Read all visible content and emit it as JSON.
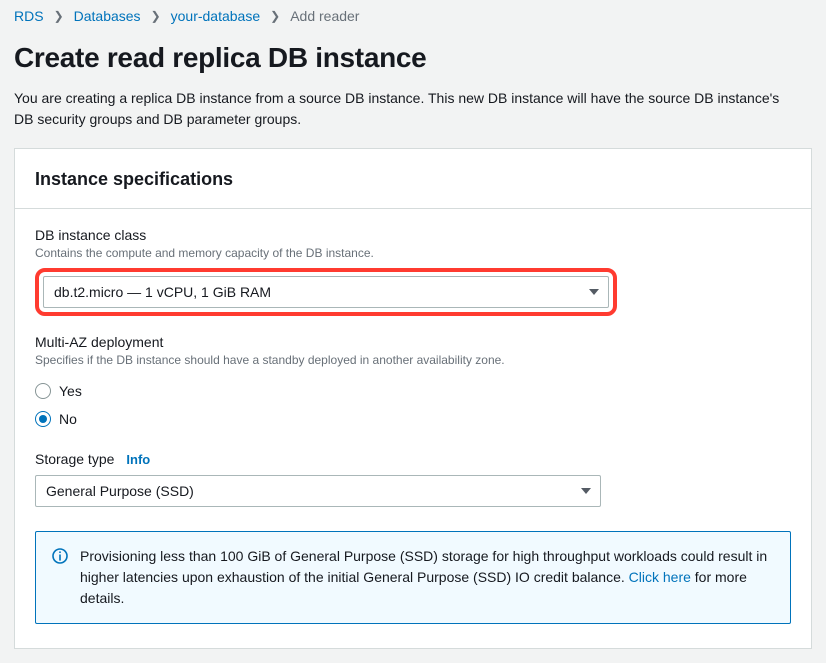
{
  "breadcrumb": {
    "items": [
      {
        "label": "RDS"
      },
      {
        "label": "Databases"
      },
      {
        "label": "your-database"
      }
    ],
    "current": "Add reader"
  },
  "page": {
    "title": "Create read replica DB instance",
    "description": "You are creating a replica DB instance from a source DB instance. This new DB instance will have the source DB instance's DB security groups and DB parameter groups."
  },
  "card": {
    "title": "Instance specifications"
  },
  "instance_class": {
    "label": "DB instance class",
    "help": "Contains the compute and memory capacity of the DB instance.",
    "value": "db.t2.micro — 1 vCPU, 1 GiB RAM"
  },
  "multi_az": {
    "label": "Multi-AZ deployment",
    "help": "Specifies if the DB instance should have a standby deployed in another availability zone.",
    "options": {
      "yes": "Yes",
      "no": "No"
    },
    "selected": "no"
  },
  "storage_type": {
    "label": "Storage type",
    "info": "Info",
    "value": "General Purpose (SSD)"
  },
  "alert": {
    "text_before": "Provisioning less than 100 GiB of General Purpose (SSD) storage for high throughput workloads could result in higher latencies upon exhaustion of the initial General Purpose (SSD) IO credit balance. ",
    "link": "Click here",
    "text_after": " for more details."
  }
}
